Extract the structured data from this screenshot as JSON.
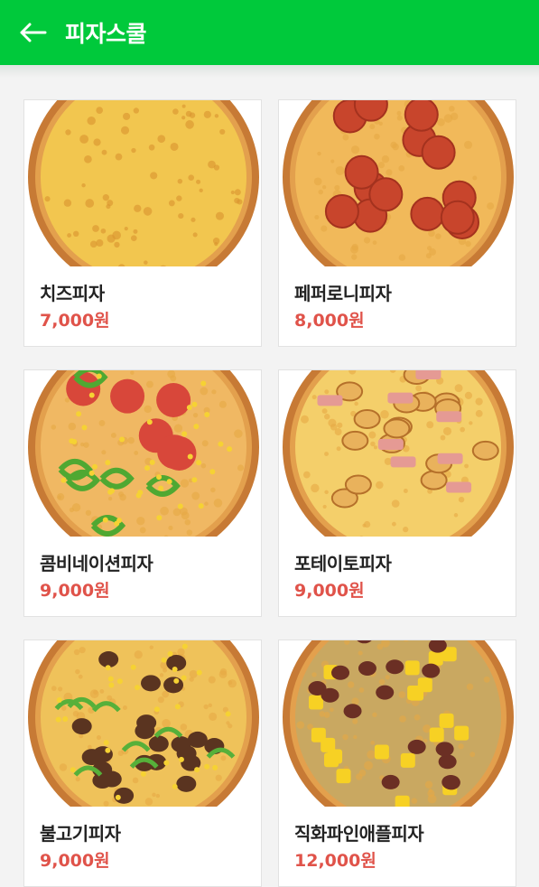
{
  "header": {
    "title": "피자스쿨",
    "back_icon": "arrow-left-icon",
    "bg_color": "#00c93b"
  },
  "colors": {
    "price": "#e0534a"
  },
  "products": [
    {
      "name": "치즈피자",
      "price": "7,000원",
      "type": "cheese"
    },
    {
      "name": "페퍼로니피자",
      "price": "8,000원",
      "type": "pepperoni"
    },
    {
      "name": "콤비네이션피자",
      "price": "9,000원",
      "type": "combination"
    },
    {
      "name": "포테이토피자",
      "price": "9,000원",
      "type": "potato"
    },
    {
      "name": "불고기피자",
      "price": "9,000원",
      "type": "bulgogi"
    },
    {
      "name": "직화파인애플피자",
      "price": "12,000원",
      "type": "pineapple"
    }
  ]
}
